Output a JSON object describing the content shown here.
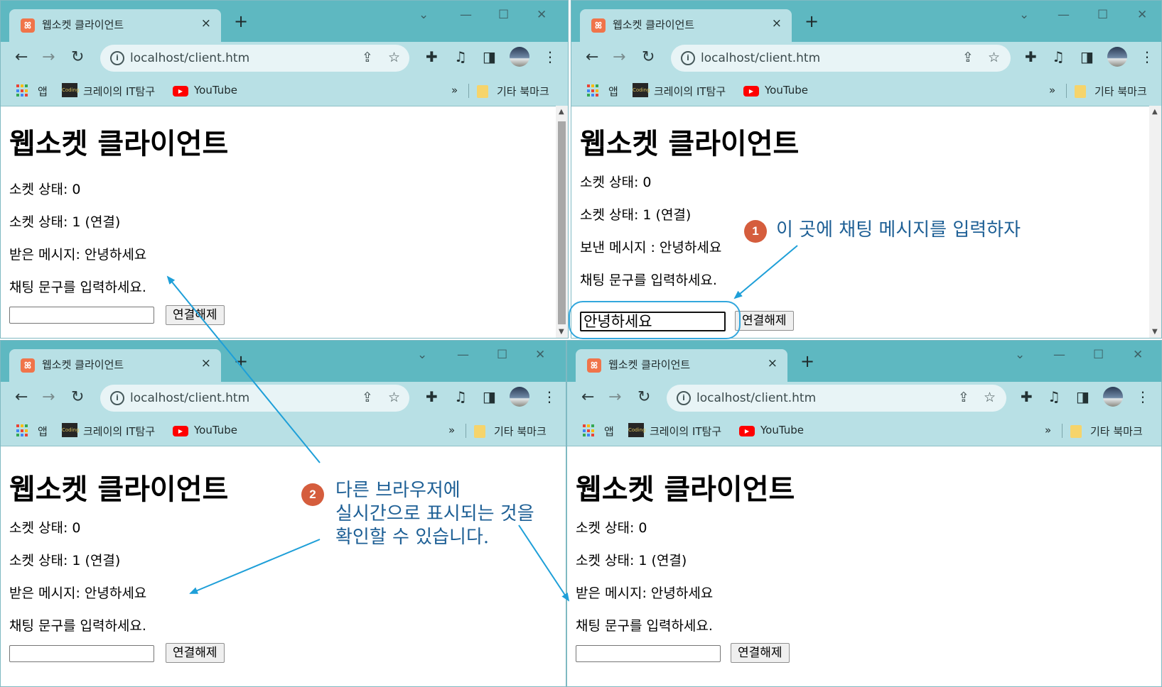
{
  "browser": {
    "tab_title": "웹소켓 클라이언트",
    "tab_favicon": "xampp-icon",
    "tab_close": "×",
    "new_tab": "+",
    "window_controls": {
      "tabs": "⌄",
      "minimize": "—",
      "maximize": "☐",
      "close": "✕"
    },
    "nav": {
      "back": "←",
      "forward": "→",
      "reload": "↻"
    },
    "url": "localhost/client.htm",
    "bookmarks": {
      "apps": "앱",
      "blog": "크레이의 IT탐구",
      "youtube": "YouTube",
      "more": "»",
      "other": "기타 북마크"
    }
  },
  "windows": [
    {
      "id": "top-left",
      "heading": "웹소켓 클라이언트",
      "lines": [
        "소켓 상태: 0",
        "소켓 상태: 1 (연결)",
        "받은 메시지: 안녕하세요",
        "채팅 문구를 입력하세요."
      ],
      "input_value": "",
      "button": "연결해제"
    },
    {
      "id": "top-right",
      "heading": "웹소켓 클라이언트",
      "lines": [
        "소켓 상태: 0",
        "소켓 상태: 1 (연결)",
        "보낸 메시지 : 안녕하세요",
        "채팅 문구를 입력하세요."
      ],
      "input_value": "안녕하세요",
      "button": "연결해제"
    },
    {
      "id": "bottom-left",
      "heading": "웹소켓 클라이언트",
      "lines": [
        "소켓 상태: 0",
        "소켓 상태: 1 (연결)",
        "받은 메시지: 안녕하세요",
        "채팅 문구를 입력하세요."
      ],
      "input_value": "",
      "button": "연결해제"
    },
    {
      "id": "bottom-right",
      "heading": "웹소켓 클라이언트",
      "lines": [
        "소켓 상태: 0",
        "소켓 상태: 1 (연결)",
        "받은 메시지: 안녕하세요",
        "채팅 문구를 입력하세요."
      ],
      "input_value": "",
      "button": "연결해제"
    }
  ],
  "annotations": {
    "step1": {
      "number": "1",
      "text": "이 곳에 채팅 메시지를 입력하자"
    },
    "step2": {
      "number": "2",
      "lines": [
        "다른 브라우저에",
        "실시간으로 표시되는 것을",
        "확인할 수 있습니다."
      ]
    }
  },
  "colors": {
    "tab_strip": "#5eb8c1",
    "toolbar": "#b8e0e5",
    "annotation_text": "#1d5f95",
    "annotation_arrow": "#1e9fd8",
    "badge": "#d55d3d"
  }
}
